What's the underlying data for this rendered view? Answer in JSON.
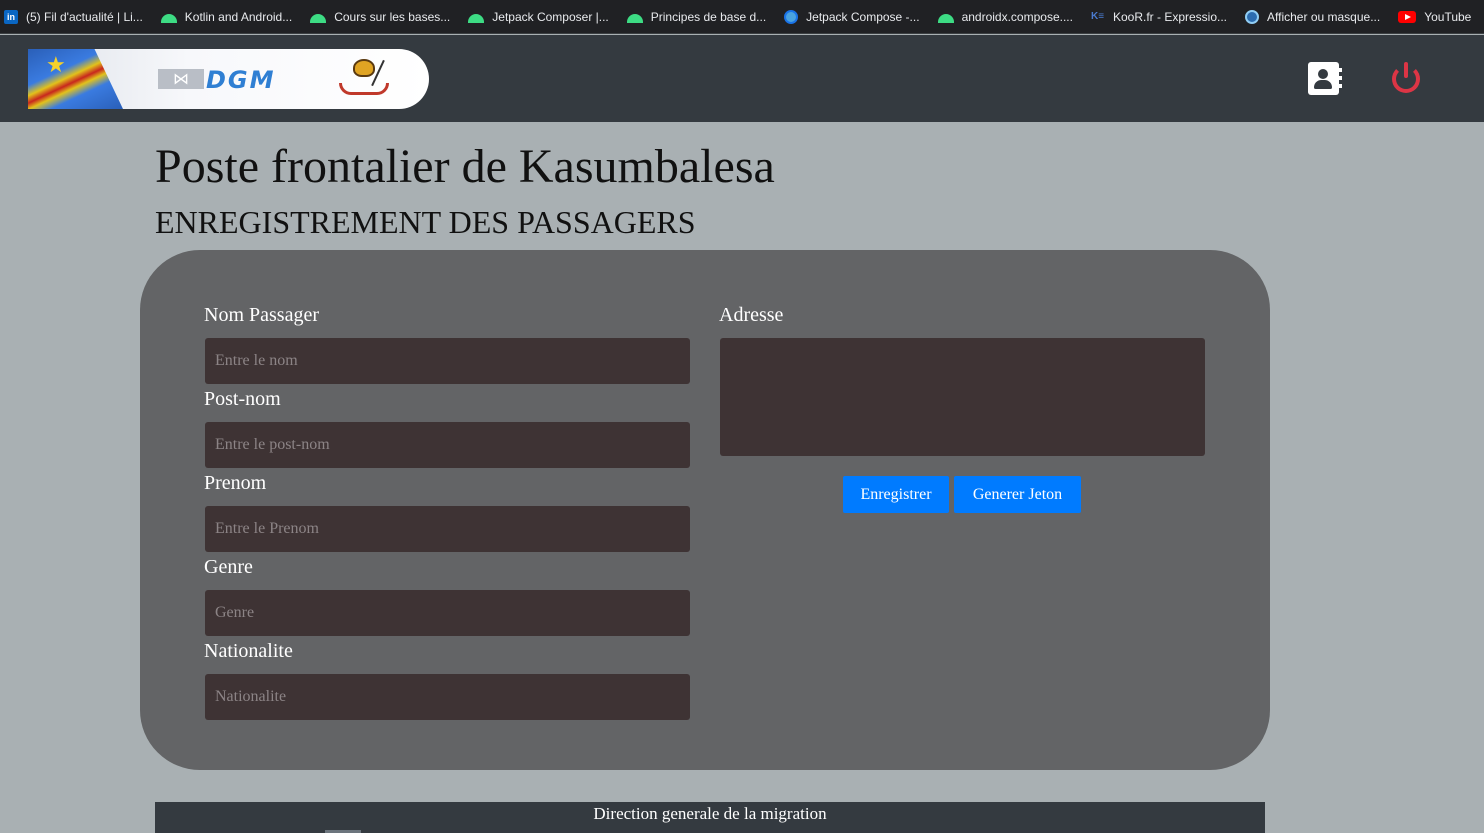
{
  "bookmarks": [
    {
      "icon": "linkedin-icon",
      "label": "(5) Fil d'actualité | Li..."
    },
    {
      "icon": "android-icon",
      "label": "Kotlin and Android..."
    },
    {
      "icon": "android-icon",
      "label": "Cours sur les bases..."
    },
    {
      "icon": "android-icon",
      "label": "Jetpack Composer |..."
    },
    {
      "icon": "android-icon",
      "label": "Principes de base d..."
    },
    {
      "icon": "globe-icon",
      "label": "Jetpack Compose -..."
    },
    {
      "icon": "android-icon",
      "label": "androidx.compose...."
    },
    {
      "icon": "koor-icon",
      "label": "KooR.fr - Expressio..."
    },
    {
      "icon": "edge-icon",
      "label": "Afficher ou masque..."
    },
    {
      "icon": "youtube-icon",
      "label": "YouTube"
    }
  ],
  "header": {
    "logo_text": "DGM",
    "logo_mark": "⋈",
    "contact_icon": "contact-book-icon",
    "power_icon": "power-icon"
  },
  "page": {
    "title": "Poste frontalier de Kasumbalesa",
    "subtitle": "ENREGISTREMENT DES PASSAGERS"
  },
  "form": {
    "nom_label": "Nom Passager",
    "nom_placeholder": "Entre le nom",
    "postnom_label": "Post-nom",
    "postnom_placeholder": "Entre le post-nom",
    "prenom_label": "Prenom",
    "prenom_placeholder": "Entre le Prenom",
    "genre_label": "Genre",
    "genre_placeholder": "Genre",
    "nationalite_label": "Nationalite",
    "nationalite_placeholder": "Nationalite",
    "adresse_label": "Adresse",
    "adresse_value": "",
    "save_button": "Enregistrer",
    "token_button": "Generer Jeton"
  },
  "footer": {
    "text": "Direction generale de la migration"
  },
  "colors": {
    "primary_button": "#007bff",
    "power_icon": "#dc3545",
    "navbar": "#343a40",
    "panel": "#636466",
    "input_bg": "#3e3334"
  }
}
